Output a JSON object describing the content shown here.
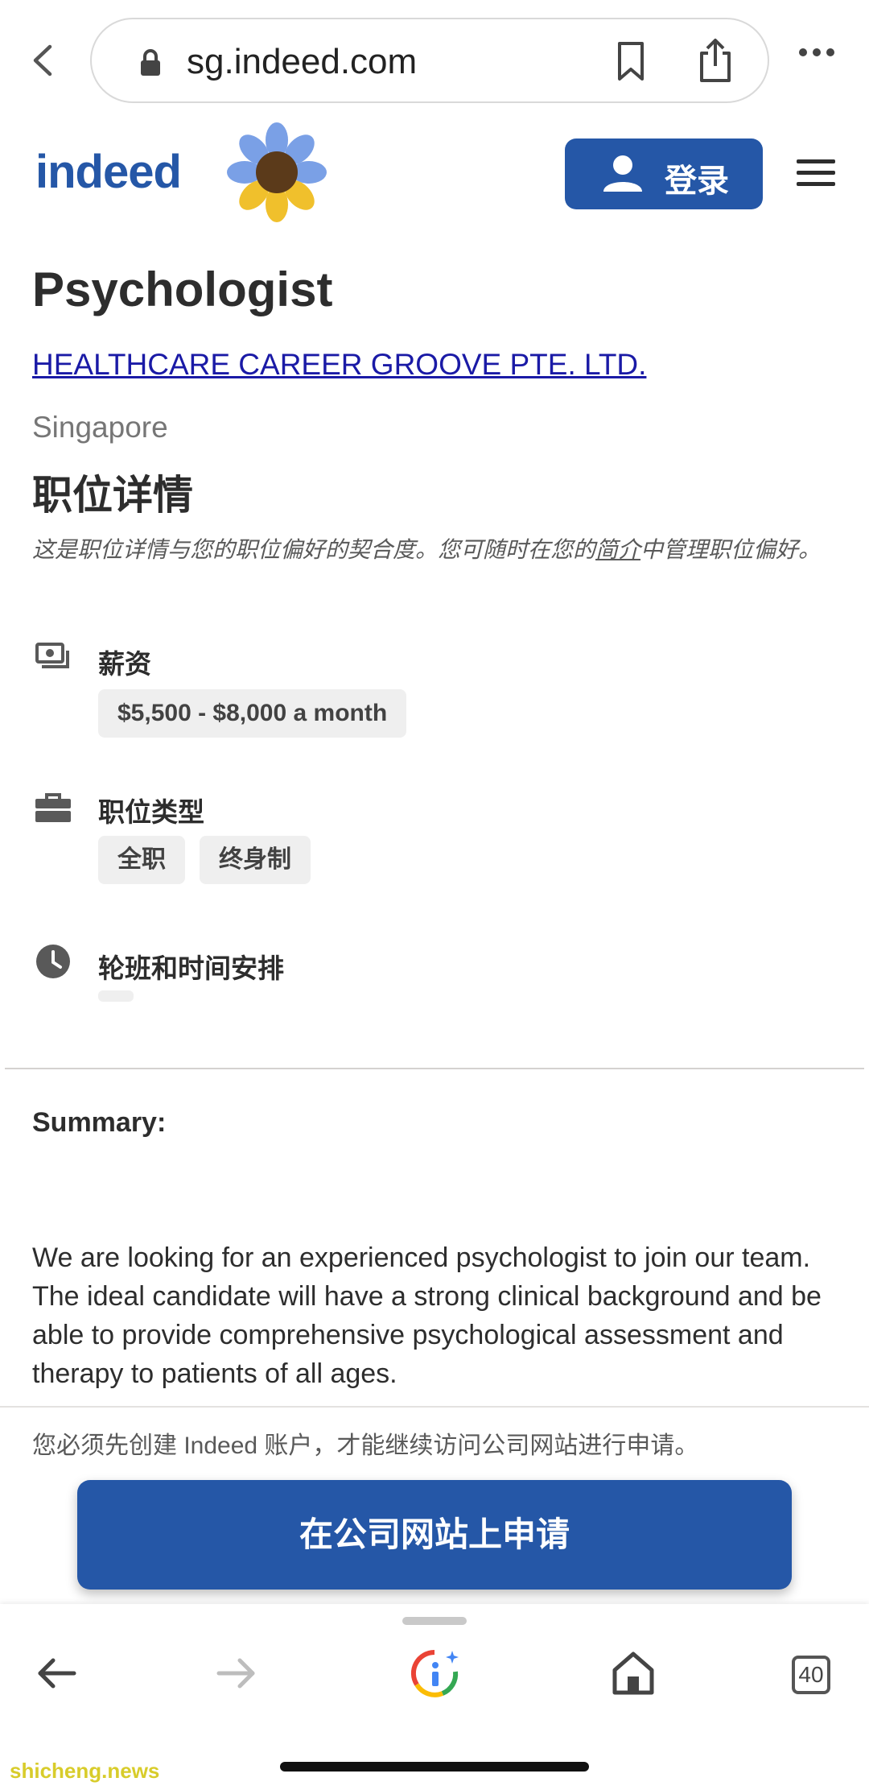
{
  "browser": {
    "url": "sg.indeed.com",
    "tab_count": "40"
  },
  "header": {
    "logo": "indeed",
    "login_label": "登录"
  },
  "job": {
    "title": "Psychologist",
    "company": "HEALTHCARE CAREER GROOVE PTE. LTD.",
    "location": "Singapore",
    "details_heading": "职位详情",
    "note_before": "这是职位详情与您的职位偏好的契合度。您可随时在您的",
    "note_link": "简介",
    "note_after": "中管理职位偏好。",
    "salary_heading": "薪资",
    "salary_value": "$5,500 - $8,000 a month",
    "type_heading": "职位类型",
    "type_values": [
      "全职",
      "终身制"
    ],
    "shift_heading": "轮班和时间安排",
    "summary_heading": "Summary:",
    "summary_text": "We are looking for an experienced psychologist to join our team. The ideal candidate will have a strong clinical background and be able to provide comprehensive psychological assessment and therapy to patients of all ages."
  },
  "apply": {
    "note": "您必须先创建 Indeed 账户，才能继续访问公司网站进行申请。",
    "button_label": "在公司网站上申请"
  },
  "icons": {
    "back": "chevron-left-icon",
    "lock": "lock-icon",
    "bookmark": "bookmark-icon",
    "share": "share-icon",
    "more": "more-icon",
    "menu": "hamburger-menu-icon",
    "salary": "money-icon",
    "job_type": "briefcase-icon",
    "shift": "clock-icon"
  },
  "watermark": "shicheng.news",
  "colors": {
    "brand": "#2557a7",
    "link": "#1a1aa6"
  }
}
